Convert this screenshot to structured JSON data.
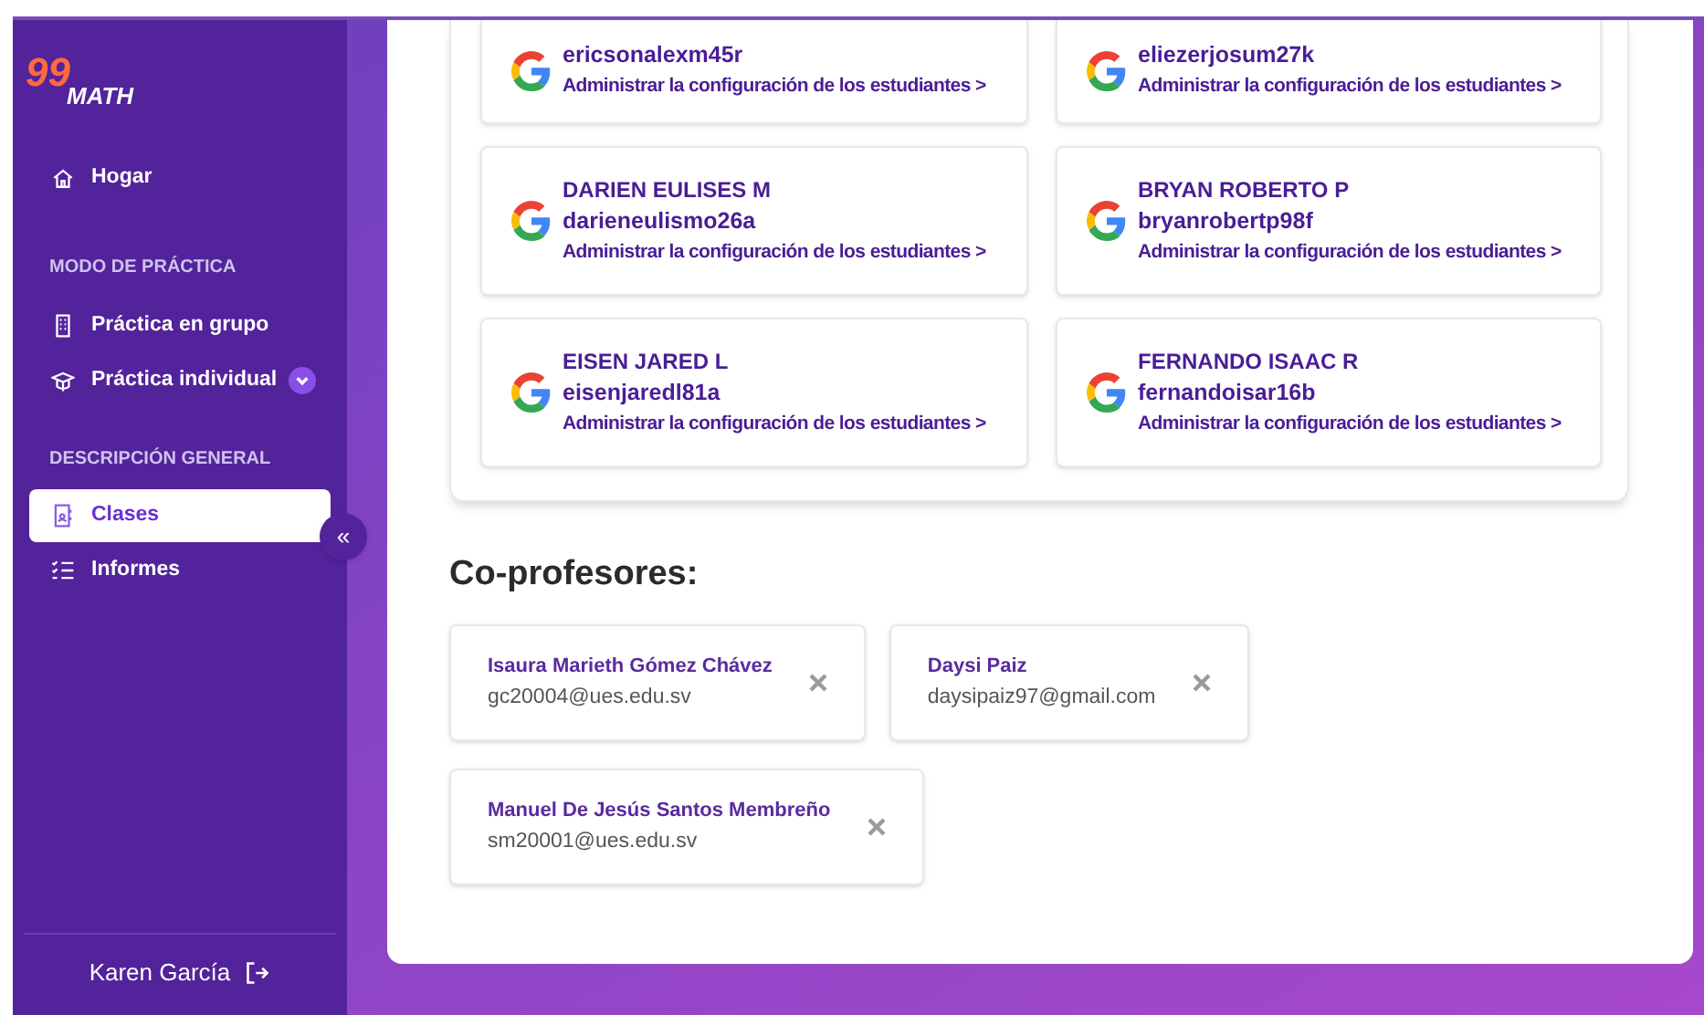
{
  "sidebar": {
    "logo": {
      "digits": "99",
      "word": "MATH"
    },
    "sections": [
      {
        "items": [
          {
            "label": "Hogar",
            "selected": false
          }
        ]
      },
      {
        "heading": "MODO DE PRÁCTICA",
        "items": [
          {
            "label": "Práctica en grupo",
            "selected": false
          },
          {
            "label": "Práctica individual",
            "selected": false,
            "has_dropdown": true
          }
        ]
      },
      {
        "heading": "DESCRIPCIÓN GENERAL",
        "items": [
          {
            "label": "Clases",
            "selected": true
          },
          {
            "label": "Informes",
            "selected": false
          }
        ]
      }
    ],
    "collapse_button": "«",
    "user": "Karen García"
  },
  "students": [
    {
      "username": "ericsonalexm45r",
      "link": "Administrar la configuración de los estudiantes >"
    },
    {
      "username": "eliezerjosum27k",
      "link": "Administrar la configuración de los estudiantes >"
    },
    {
      "name": "DARIEN EULISES M",
      "username": "darieneulismo26a",
      "link": "Administrar la configuración de los estudiantes >"
    },
    {
      "name": "BRYAN ROBERTO P",
      "username": "bryanrobertp98f",
      "link": "Administrar la configuración de los estudiantes >"
    },
    {
      "name": "EISEN JARED L",
      "username": "eisenjaredl81a",
      "link": "Administrar la configuración de los estudiantes >"
    },
    {
      "name": "FERNANDO ISAAC R",
      "username": "fernandoisar16b",
      "link": "Administrar la configuración de los estudiantes >"
    }
  ],
  "coteachers": {
    "heading": "Co-profesores:",
    "items": [
      {
        "name": "Isaura Marieth Gómez Chávez",
        "email": "gc20004@ues.edu.sv"
      },
      {
        "name": "Daysi Paiz",
        "email": "daysipaiz97@gmail.com"
      },
      {
        "name": "Manuel De Jesús Santos Membreño",
        "email": "sm20001@ues.edu.sv"
      }
    ]
  }
}
